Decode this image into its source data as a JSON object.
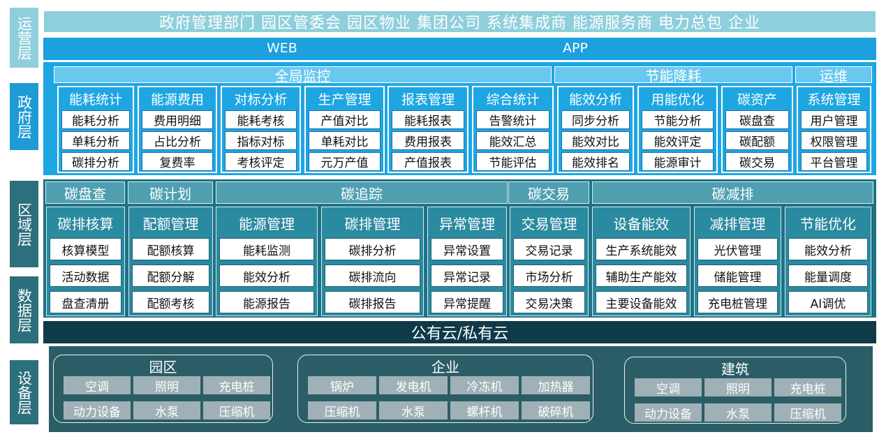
{
  "layers": {
    "ops": "运营层",
    "gov": "政府层",
    "region": "区域层",
    "data": "数据层",
    "device": "设备层"
  },
  "ops_bar": "政府管理部门 园区管委会 园区物业 集团公司 系统集成商 能源服务商 电力总包 企业",
  "web": "WEB",
  "app": "APP",
  "gov": {
    "sections": [
      "全局监控",
      "节能降耗",
      "运维"
    ],
    "groups": [
      {
        "title": "能耗统计",
        "items": [
          "能耗分析",
          "单耗分析",
          "碳排分析"
        ]
      },
      {
        "title": "能源费用",
        "items": [
          "费用明细",
          "占比分析",
          "复费率"
        ]
      },
      {
        "title": "对标分析",
        "items": [
          "能耗考核",
          "指标对标",
          "考核评定"
        ]
      },
      {
        "title": "生产管理",
        "items": [
          "产值对比",
          "单耗对比",
          "元万产值"
        ]
      },
      {
        "title": "报表管理",
        "items": [
          "能耗报表",
          "费用报表",
          "产值报表"
        ]
      },
      {
        "title": "综合统计",
        "items": [
          "告警统计",
          "能效汇总",
          "节能评估"
        ]
      },
      {
        "title": "能效分析",
        "items": [
          "同步分析",
          "能效对比",
          "能效排名"
        ]
      },
      {
        "title": "用能优化",
        "items": [
          "节能分析",
          "能效评定",
          "能源审计"
        ]
      },
      {
        "title": "碳资产",
        "items": [
          "碳盘查",
          "碳配额",
          "碳交易"
        ]
      },
      {
        "title": "系统管理",
        "items": [
          "用户管理",
          "权限管理",
          "平台管理"
        ]
      }
    ]
  },
  "region": {
    "sections": [
      "碳盘查",
      "碳计划",
      "碳追踪",
      "碳交易",
      "碳减排"
    ],
    "groups": [
      {
        "title": "碳排核算",
        "items": [
          "核算模型",
          "活动数据",
          "盘查清册"
        ]
      },
      {
        "title": "配额管理",
        "items": [
          "配额核算",
          "配额分解",
          "配额考核"
        ]
      },
      {
        "title": "能源管理",
        "items": [
          "能耗监测",
          "能效分析",
          "能源报告"
        ]
      },
      {
        "title": "碳排管理",
        "items": [
          "碳排分析",
          "碳排流向",
          "碳排报告"
        ]
      },
      {
        "title": "异常管理",
        "items": [
          "异常设置",
          "异常记录",
          "异常提醒"
        ]
      },
      {
        "title": "交易管理",
        "items": [
          "交易记录",
          "市场分析",
          "交易决策"
        ]
      },
      {
        "title": "设备能效",
        "items": [
          "生产系统能效",
          "辅助生产能效",
          "主要设备能效"
        ]
      },
      {
        "title": "减排管理",
        "items": [
          "光伏管理",
          "储能管理",
          "充电桩管理"
        ]
      },
      {
        "title": "节能优化",
        "items": [
          "能效分析",
          "能量调度",
          "AI调优"
        ]
      }
    ]
  },
  "cloud": "公有云/私有云",
  "devices": [
    {
      "title": "园区",
      "items": [
        "空调",
        "照明",
        "充电桩",
        "动力设备",
        "水泵",
        "压缩机"
      ]
    },
    {
      "title": "企业",
      "items": [
        "锅炉",
        "发电机",
        "冷冻机",
        "加热器",
        "压缩机",
        "水泵",
        "螺杆机",
        "破碎机"
      ]
    },
    {
      "title": "建筑",
      "items": [
        "空调",
        "照明",
        "充电桩",
        "动力设备",
        "水泵",
        "压缩机"
      ]
    }
  ]
}
